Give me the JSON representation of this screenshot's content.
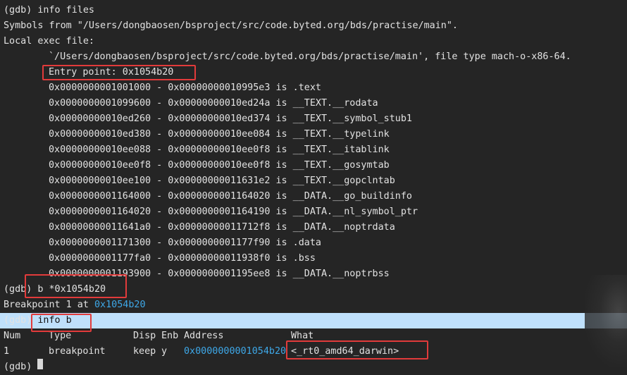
{
  "terminal": {
    "top_fragment": "",
    "cmd_info_files": "(gdb) info files",
    "symbols_from": "Symbols from \"/Users/dongbaosen/bsproject/src/code.byted.org/bds/practise/main\".",
    "local_exec": "Local exec file:",
    "exec_path": "`/Users/dongbaosen/bsproject/src/code.byted.org/bds/practise/main', file type mach-o-x86-64.",
    "entry_point": "Entry point: 0x1054b20",
    "sections": [
      "0x0000000001001000 - 0x00000000010995e3 is .text",
      "0x0000000001099600 - 0x00000000010ed24a is __TEXT.__rodata",
      "0x00000000010ed260 - 0x00000000010ed374 is __TEXT.__symbol_stub1",
      "0x00000000010ed380 - 0x00000000010ee084 is __TEXT.__typelink",
      "0x00000000010ee088 - 0x00000000010ee0f8 is __TEXT.__itablink",
      "0x00000000010ee0f8 - 0x00000000010ee0f8 is __TEXT.__gosymtab",
      "0x00000000010ee100 - 0x00000000011631e2 is __TEXT.__gopclntab",
      "0x0000000001164000 - 0x0000000001164020 is __DATA.__go_buildinfo",
      "0x0000000001164020 - 0x0000000001164190 is __DATA.__nl_symbol_ptr",
      "0x00000000011641a0 - 0x00000000011712f8 is __DATA.__noptrdata",
      "0x0000000001171300 - 0x0000000001177f90 is .data",
      "0x0000000001177fa0 - 0x00000000011938f0 is .bss",
      "0x0000000001193900 - 0x0000000001195ee8 is __DATA.__noptrbss"
    ],
    "cmd_break": "(gdb) b *0x1054b20",
    "bp_set_prefix": "Breakpoint 1 at ",
    "bp_set_addr": "0x1054b20",
    "prompt": "(gdb) ",
    "cmd_info_b": "info b",
    "table_headers": {
      "num": "Num",
      "type": "Type",
      "disp": "Disp",
      "enb": "Enb",
      "address": "Address",
      "what": "What"
    },
    "bp_row": {
      "num": "1",
      "type": "breakpoint",
      "disp": "keep",
      "enb": "y",
      "address": "0x0000000001054b20",
      "what": "<_rt0_amd64_darwin>"
    },
    "last_prompt": "(gdb) "
  },
  "colors": {
    "background": "#252525",
    "text": "#e2e2e2",
    "link": "#3ea8e8",
    "highlight": "#bfe0fb",
    "annotation": "#e23b3b"
  }
}
